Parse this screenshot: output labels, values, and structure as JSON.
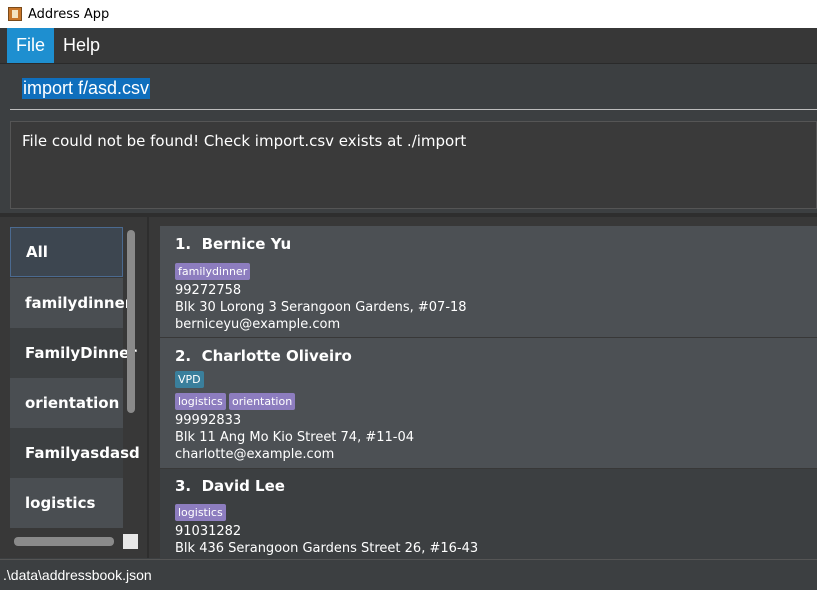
{
  "window": {
    "title": "Address App",
    "icon": "address-book-icon"
  },
  "menu": {
    "items": [
      "File",
      "Help"
    ]
  },
  "command": {
    "value": "import f/asd.csv"
  },
  "result": {
    "text": "File could not be found! Check import.csv exists at ./import"
  },
  "tags": {
    "items": [
      "All",
      "familydinner",
      "FamilyDinner",
      "orientation",
      "Familyasdasd",
      "logistics"
    ]
  },
  "persons": [
    {
      "index": "1.",
      "name": "Bernice Yu",
      "tags": [
        "familydinner"
      ],
      "phone": "99272758",
      "address": "Blk 30 Lorong 3 Serangoon Gardens, #07-18",
      "email": "berniceyu@example.com"
    },
    {
      "index": "2.",
      "name": "Charlotte Oliveiro",
      "tags": [
        "VPD",
        "logistics",
        "orientation"
      ],
      "phone": "99992833",
      "address": "Blk 11 Ang Mo Kio Street 74, #11-04",
      "email": "charlotte@example.com"
    },
    {
      "index": "3.",
      "name": "David Lee",
      "tags": [
        "logistics"
      ],
      "phone": "91031282",
      "address": "Blk 436 Serangoon Gardens Street 26, #16-43",
      "email": ""
    }
  ],
  "status": {
    "path": ".\\data\\addressbook.json"
  },
  "colors": {
    "accent": "#1e8fd0",
    "tag_purple": "#8d7dbf",
    "tag_teal": "#3a7f9c"
  }
}
